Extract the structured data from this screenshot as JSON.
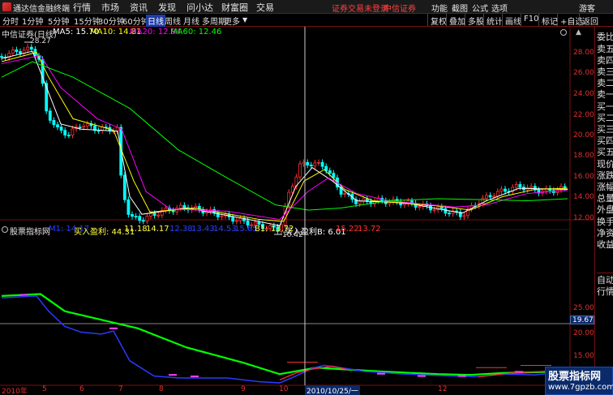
{
  "app": {
    "name": "通达信金融终端"
  },
  "menu": [
    "行情",
    "市场",
    "资讯",
    "发现",
    "问小达",
    "财富圈",
    "交易"
  ],
  "alert_text": "证券交易未登录",
  "broker_text": "中信证券",
  "right_menu": [
    "功能",
    "截图",
    "公式",
    "选项",
    "游客"
  ],
  "period_tabs": [
    "分时",
    "1分钟",
    "5分钟",
    "15分钟",
    "30分钟",
    "60分钟",
    "日线",
    "周线",
    "月线",
    "多周期",
    "更多"
  ],
  "active_period": "日线",
  "tool_buttons": [
    "复权",
    "叠加",
    "多股",
    "统计",
    "画线",
    "F10",
    "标记",
    "+自选",
    "返回"
  ],
  "stock_info": {
    "name": "中信证券(日线)",
    "ma5": "MA5: 15.70",
    "ma10": "MA10: 14.81",
    "ma20": "MA20: 12.94",
    "ma60": "MA60: 12.46"
  },
  "colors": {
    "ma5": "#ffffff",
    "ma10": "#ffff00",
    "ma20": "#ff00ff",
    "ma60": "#00ff00",
    "up": "#ff3030",
    "down": "#00ffff",
    "axis": "#e03030"
  },
  "price_high_label": "28.27",
  "price_low_label": "10.42",
  "price_ticks": [
    "28.00",
    "26.00",
    "24.00",
    "22.00",
    "20.00",
    "18.00",
    "16.00",
    "14.00",
    "12.00"
  ],
  "indicator": {
    "name": "股票指标网",
    "m1": "M1: 14.17",
    "buy_profit": "买入盈利: 44.31",
    "v1": "11.18",
    "v2": "14.17",
    "v3": "12.38",
    "v4": "13.43",
    "v5": "14.53",
    "v6": "15.65",
    "b1": "B1: 13.72",
    "buy_profit_b": "买入盈利B: 6.01",
    "v7": "15.22",
    "v8": "13.72"
  },
  "ind_ticks": [
    "25.00",
    "20.00",
    "15.00"
  ],
  "cursor_value": "19.67",
  "x_labels": [
    "2010年",
    "5",
    "6",
    "7",
    "8",
    "9",
    "10",
    "2010/10/25/一",
    "12"
  ],
  "right_panel": [
    "委比",
    "卖五",
    "卖四",
    "卖三",
    "卖二",
    "卖一",
    "买一",
    "买二",
    "买三",
    "买四",
    "买五",
    "现价",
    "涨跌",
    "涨幅",
    "总量",
    "外盘",
    "换手",
    "净资",
    "收益",
    "自动",
    "行情"
  ],
  "watermark": {
    "title": "股票指标网",
    "url": "www.7gpzb.com"
  }
}
